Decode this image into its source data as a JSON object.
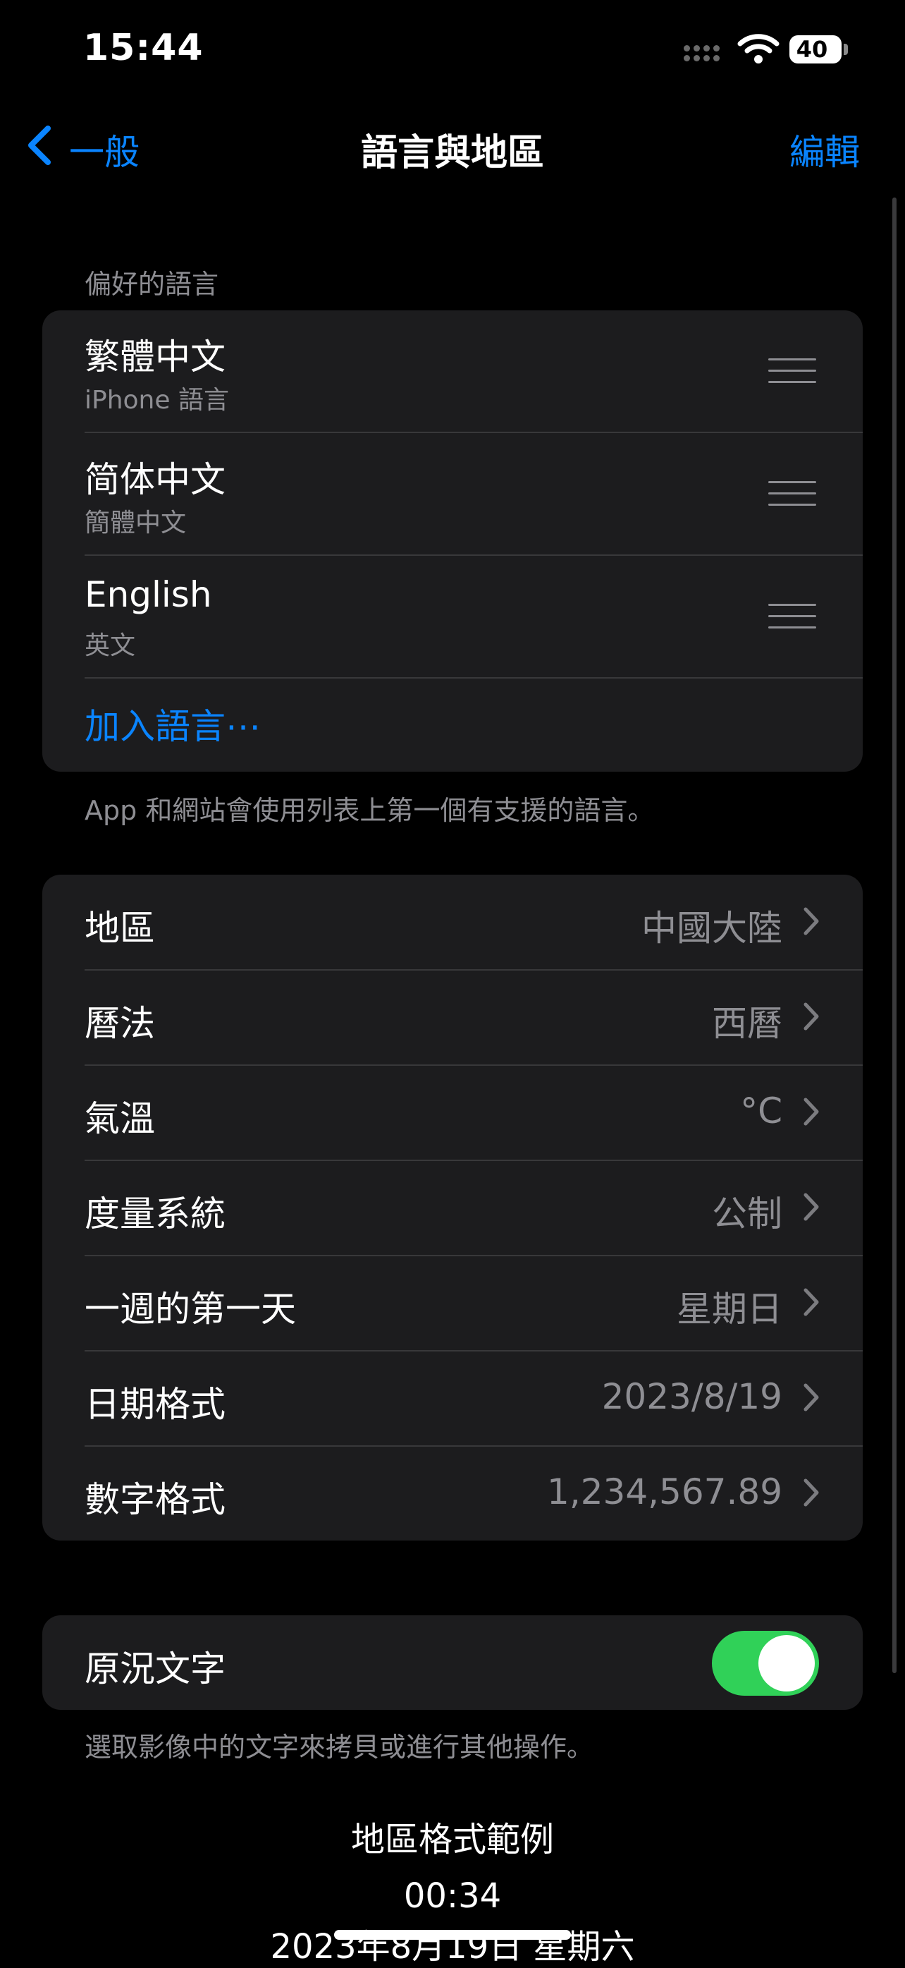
{
  "status_bar": {
    "time": "15:44",
    "battery_level": "40",
    "icons": [
      "cellular-dots-icon",
      "wifi-icon",
      "battery-icon"
    ]
  },
  "nav": {
    "back_label": "一般",
    "title": "語言與地區",
    "edit_label": "編輯"
  },
  "preferred_languages": {
    "header": "偏好的語言",
    "items": [
      {
        "title": "繁體中文",
        "subtitle": "iPhone 語言"
      },
      {
        "title": "简体中文",
        "subtitle": "簡體中文"
      },
      {
        "title": "English",
        "subtitle": "英文"
      }
    ],
    "add_label": "加入語言⋯",
    "footer": "App 和網站會使用列表上第一個有支援的語言。"
  },
  "region_settings": [
    {
      "label": "地區",
      "value": "中國大陸"
    },
    {
      "label": "曆法",
      "value": "西曆"
    },
    {
      "label": "氣溫",
      "value": "°C"
    },
    {
      "label": "度量系統",
      "value": "公制"
    },
    {
      "label": "一週的第一天",
      "value": "星期日"
    },
    {
      "label": "日期格式",
      "value": "2023/8/19"
    },
    {
      "label": "數字格式",
      "value": "1,234,567.89"
    }
  ],
  "live_text": {
    "label": "原況文字",
    "enabled": true,
    "footer": "選取影像中的文字來拷貝或進行其他操作。"
  },
  "format_example": {
    "title": "地區格式範例",
    "time": "00:34",
    "date": "2023年8月19日 星期六"
  },
  "colors": {
    "accent": "#0a84ff",
    "toggle_on": "#30d158",
    "background": "#000000",
    "card": "#1c1c1e",
    "secondary_text": "#8e8e93"
  }
}
